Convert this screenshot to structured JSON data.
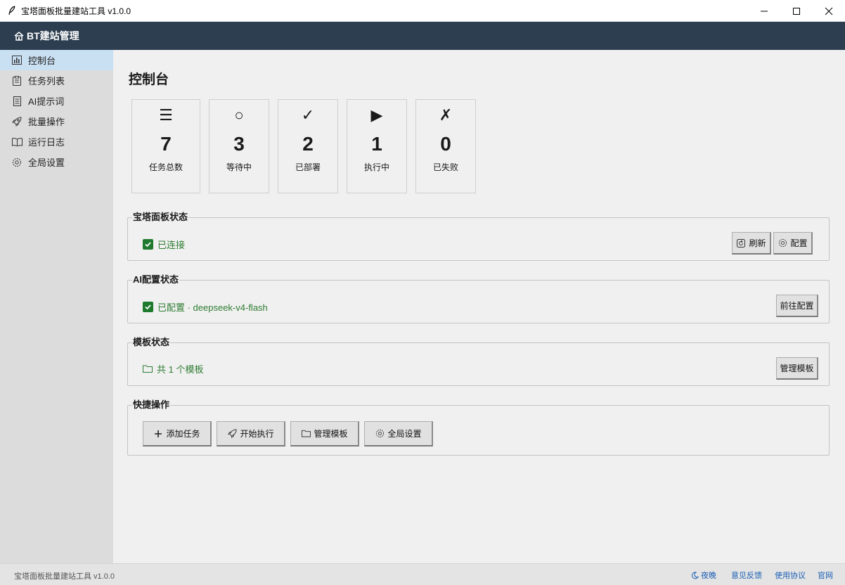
{
  "window": {
    "title": "宝塔面板批量建站工具 v1.0.0"
  },
  "header": {
    "brand": "BT建站管理"
  },
  "sidebar": {
    "items": [
      {
        "label": "控制台",
        "icon": "chart-icon",
        "active": true
      },
      {
        "label": "任务列表",
        "icon": "clipboard-icon",
        "active": false
      },
      {
        "label": "AI提示词",
        "icon": "document-icon",
        "active": false
      },
      {
        "label": "批量操作",
        "icon": "rocket-icon",
        "active": false
      },
      {
        "label": "运行日志",
        "icon": "book-icon",
        "active": false
      },
      {
        "label": "全局设置",
        "icon": "gear-icon",
        "active": false
      }
    ]
  },
  "main": {
    "title": "控制台",
    "stats": [
      {
        "icon": "☰",
        "value": "7",
        "label": "任务总数"
      },
      {
        "icon": "○",
        "value": "3",
        "label": "等待中"
      },
      {
        "icon": "✓",
        "value": "2",
        "label": "已部署"
      },
      {
        "icon": "▶",
        "value": "1",
        "label": "执行中"
      },
      {
        "icon": "✗",
        "value": "0",
        "label": "已失败"
      }
    ],
    "panel_status": {
      "title": "宝塔面板状态",
      "status": "已连接",
      "refresh_label": "刷新",
      "config_label": "配置"
    },
    "ai_status": {
      "title": "AI配置状态",
      "status": "已配置 · deepseek-v4-flash",
      "goto_label": "前往配置"
    },
    "template_status": {
      "title": "模板状态",
      "status": "共 1 个模板",
      "manage_label": "管理模板"
    },
    "quick_actions": {
      "title": "快捷操作",
      "add_task": "添加任务",
      "start": "开始执行",
      "manage_templates": "管理模板",
      "settings": "全局设置"
    }
  },
  "statusbar": {
    "version": "宝塔面板批量建站工具 v1.0.0",
    "night": "夜晚",
    "feedback": "意见反馈",
    "agreement": "使用协议",
    "website": "官网"
  },
  "colors": {
    "header_bg": "#2c3e50",
    "sidebar_bg": "#dcdcdc",
    "active_nav": "#c9dff2",
    "success": "#2e7d32",
    "link": "#1a5fb4"
  }
}
